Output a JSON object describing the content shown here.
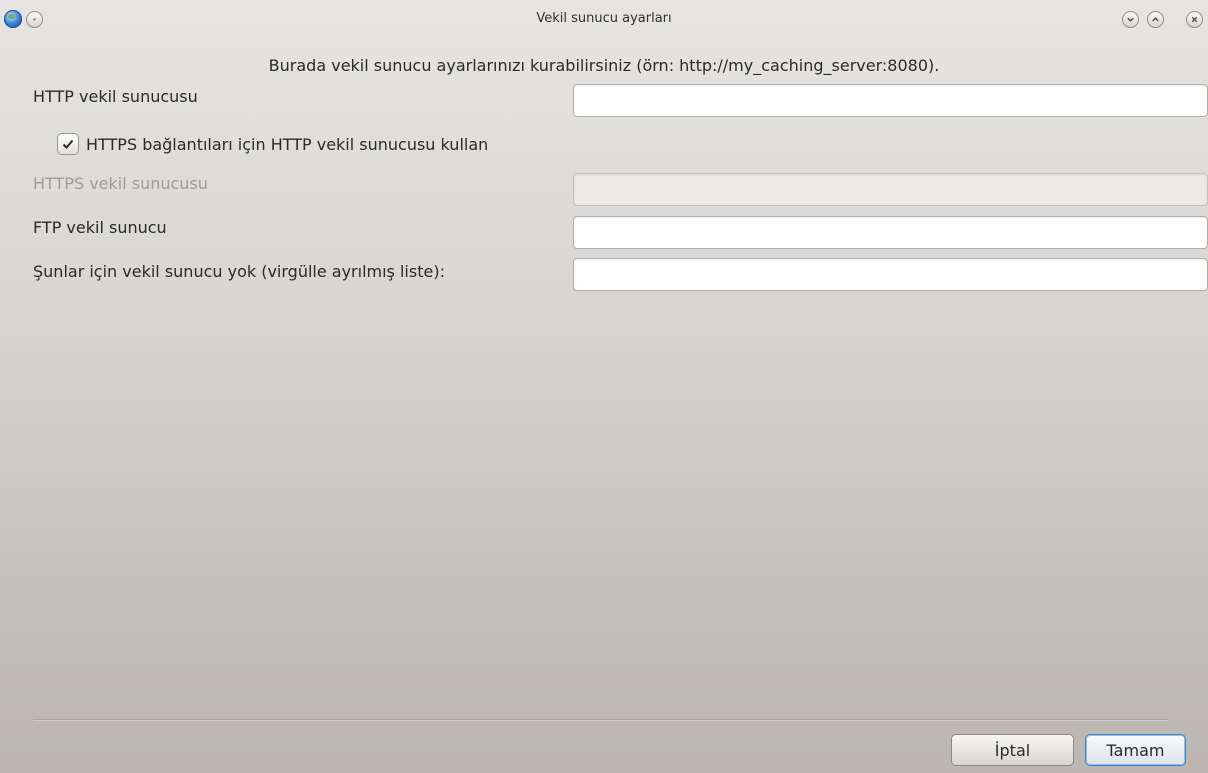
{
  "window": {
    "title": "Vekil sunucu ayarları",
    "icon": "mageia-globe-icon",
    "controls": [
      "minimize-icon",
      "maximize-icon",
      "close-icon"
    ]
  },
  "intro_text": "Burada vekil sunucu ayarlarınızı kurabilirsiniz (örn: http://my_caching_server:8080).",
  "fields": {
    "http_proxy": {
      "label": "HTTP vekil sunucusu",
      "value": ""
    },
    "https_checkbox": {
      "label": "HTTPS bağlantıları için HTTP vekil sunucusu kullan",
      "checked": true
    },
    "https_proxy": {
      "label": "HTTPS vekil sunucusu",
      "value": "",
      "disabled": true
    },
    "ftp_proxy": {
      "label": "FTP vekil sunucu",
      "value": ""
    },
    "no_proxy": {
      "label": "Şunlar için vekil sunucu yok (virgülle ayrılmış liste):",
      "value": ""
    }
  },
  "buttons": {
    "cancel": "İptal",
    "ok": "Tamam"
  },
  "colors": {
    "accent": "#3d86c6",
    "disabled_text": "#9e9a96"
  }
}
